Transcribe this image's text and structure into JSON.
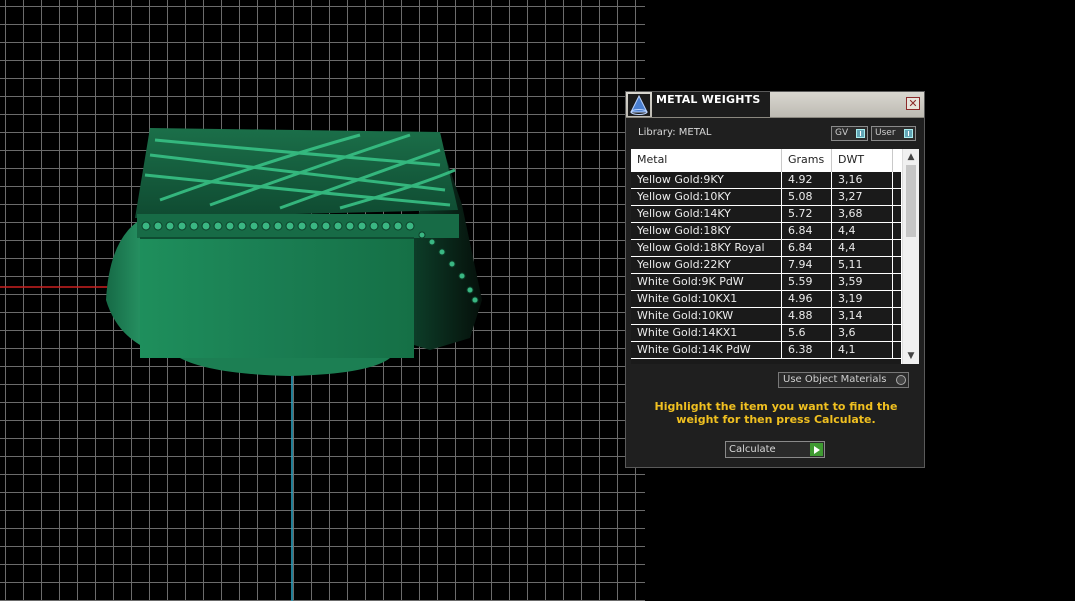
{
  "panel": {
    "title": "METAL WEIGHTS",
    "library_label": "Library: METAL",
    "gv_label": "GV",
    "user_label": "User",
    "columns": [
      "Metal",
      "Grams",
      "DWT"
    ],
    "rows": [
      {
        "metal": "Yellow Gold:9KY",
        "grams": "4.92",
        "dwt": "3,16"
      },
      {
        "metal": "Yellow Gold:10KY",
        "grams": "5.08",
        "dwt": "3,27"
      },
      {
        "metal": "Yellow Gold:14KY",
        "grams": "5.72",
        "dwt": "3,68"
      },
      {
        "metal": "Yellow Gold:18KY",
        "grams": "6.84",
        "dwt": "4,4"
      },
      {
        "metal": "Yellow Gold:18KY Royal",
        "grams": "6.84",
        "dwt": "4,4"
      },
      {
        "metal": "Yellow Gold:22KY",
        "grams": "7.94",
        "dwt": "5,11"
      },
      {
        "metal": "White Gold:9K PdW",
        "grams": "5.59",
        "dwt": "3,59"
      },
      {
        "metal": "White Gold:10KX1",
        "grams": "4.96",
        "dwt": "3,19"
      },
      {
        "metal": "White Gold:10KW",
        "grams": "4.88",
        "dwt": "3,14"
      },
      {
        "metal": "White Gold:14KX1",
        "grams": "5.6",
        "dwt": "3,6"
      },
      {
        "metal": "White Gold:14K PdW",
        "grams": "6.38",
        "dwt": "4,1"
      }
    ],
    "use_object_materials": "Use Object Materials",
    "hint": "Highlight the item you want to find the weight for then press Calculate.",
    "calculate_label": "Calculate"
  },
  "colors": {
    "ring": "#1f8a5c",
    "hint": "#f0c020",
    "calculate_arrow": "#3f9a32"
  }
}
